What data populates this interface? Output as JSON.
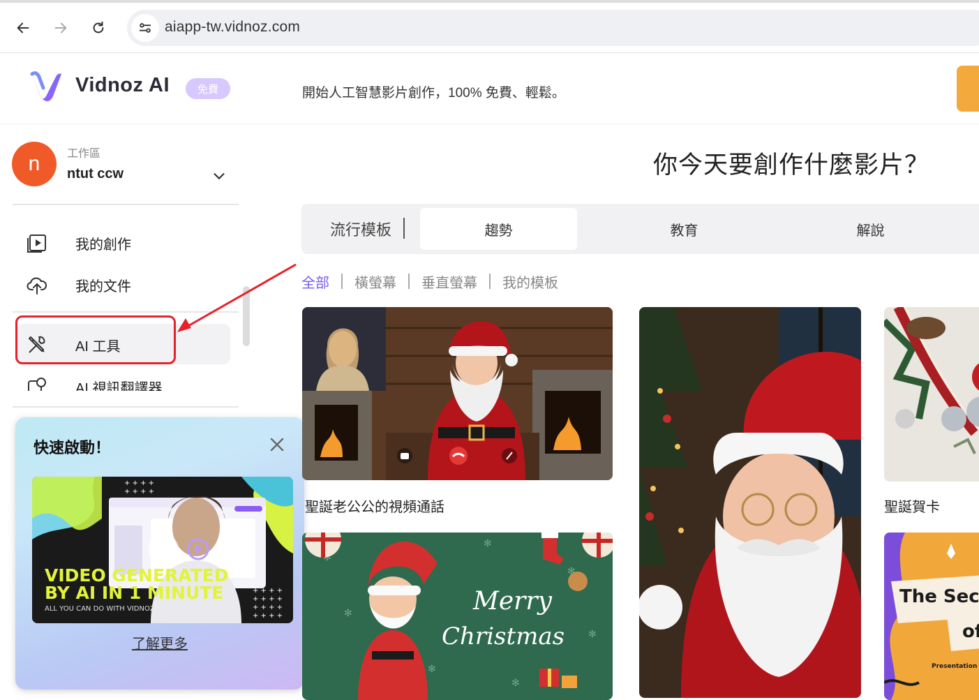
{
  "browser": {
    "url": "aiapp-tw.vidnoz.com"
  },
  "header": {
    "logo_text": "Vidnoz AI",
    "free_badge": "免費",
    "tagline": "開始人工智慧影片創作，100% 免費、輕鬆。"
  },
  "workspace": {
    "avatar_letter": "n",
    "label": "工作區",
    "name": "ntut ccw"
  },
  "sidebar": {
    "items": [
      {
        "label": "我的創作",
        "icon": "play-video-icon"
      },
      {
        "label": "我的文件",
        "icon": "cloud-upload-icon"
      },
      {
        "label": "AI 工具",
        "icon": "tools-icon",
        "active": true
      },
      {
        "label": "AI 視訊翻譯器",
        "icon": "video-translate-icon"
      }
    ]
  },
  "quick_start": {
    "title": "快速啟動！",
    "video_headline_1": "VIDEO GENERATED",
    "video_headline_2": "BY AI IN 1 MINUTE",
    "video_sub": "ALL YOU CAN DO WITH VIDNOZ",
    "link": "了解更多"
  },
  "main": {
    "title": "你今天要創作什麼影片？",
    "tabs": [
      "流行模板",
      "趨勢",
      "教育",
      "解說"
    ],
    "active_tab": "趨勢",
    "filters": [
      "全部",
      "橫螢幕",
      "垂直螢幕",
      "我的模板"
    ],
    "active_filter": "全部",
    "cards": [
      {
        "label": "聖誕老公公的視頻通話"
      },
      {
        "label": ""
      },
      {
        "label": "聖誕賀卡"
      },
      {
        "label": "",
        "overlay_1": "Merry",
        "overlay_2": "Christmas"
      },
      {
        "label": "",
        "overlay_1": "The Sec",
        "overlay_2": "of",
        "overlay_3": "Presentation By V"
      }
    ]
  },
  "colors": {
    "accent_purple": "#7c5cf0",
    "badge_purple": "#d7c8ff",
    "avatar_orange": "#f05a28",
    "highlight_red": "#e8202a",
    "cta_orange": "#f4a93c"
  }
}
